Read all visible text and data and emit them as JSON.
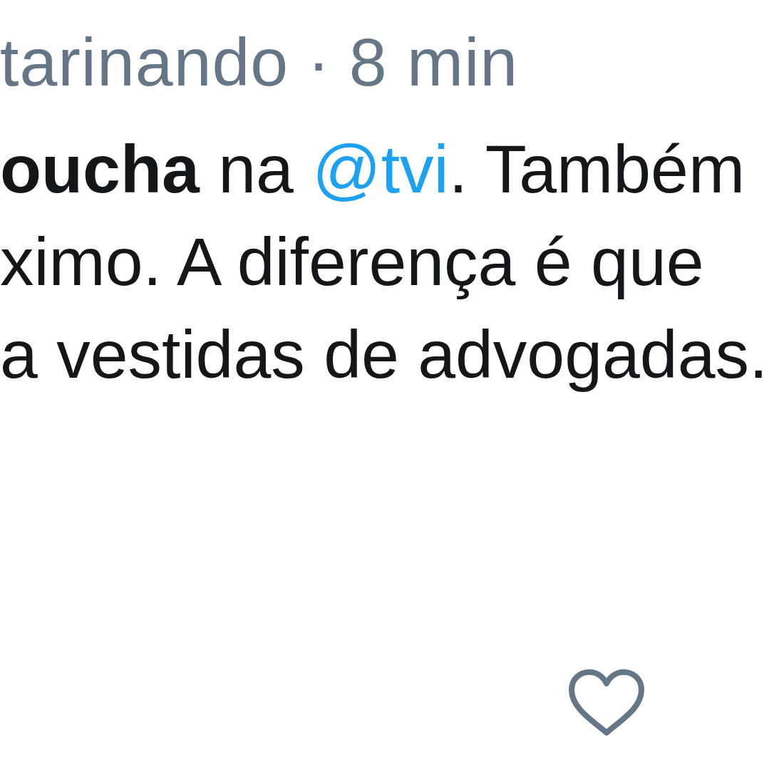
{
  "tweet": {
    "header": {
      "handle": "tarinando",
      "separator": "·",
      "time": "8 min"
    },
    "body_lines": [
      [
        {
          "kind": "bold",
          "text": "oucha"
        },
        {
          "kind": "plain",
          "text": " na "
        },
        {
          "kind": "mention",
          "text": "@tvi"
        },
        {
          "kind": "plain",
          "text": ". Também"
        }
      ],
      [
        {
          "kind": "plain",
          "text": "ximo. A diferença é que"
        }
      ],
      [
        {
          "kind": "plain",
          "text": "a vestidas de advogadas."
        }
      ]
    ],
    "actions": [
      {
        "kind": "like"
      }
    ]
  }
}
